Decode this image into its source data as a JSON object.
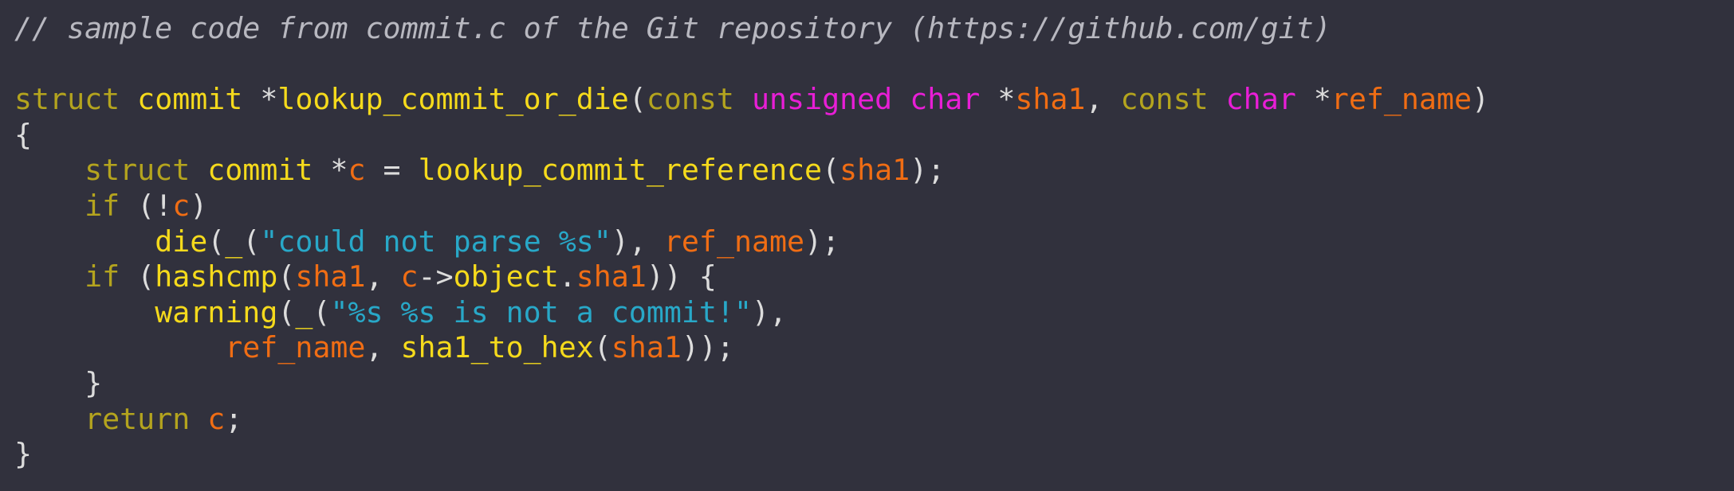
{
  "code": {
    "lines": [
      [
        {
          "t": "// sample code from commit.c of the Git repository (https://github.com/git)",
          "c": "comment"
        }
      ],
      [],
      [
        {
          "t": "struct",
          "c": "kw"
        },
        {
          "t": " ",
          "c": "pl"
        },
        {
          "t": "commit",
          "c": "fn"
        },
        {
          "t": " *",
          "c": "pl"
        },
        {
          "t": "lookup_commit_or_die",
          "c": "fn"
        },
        {
          "t": "(",
          "c": "pl"
        },
        {
          "t": "const",
          "c": "kw"
        },
        {
          "t": " ",
          "c": "pl"
        },
        {
          "t": "unsigned",
          "c": "kw2"
        },
        {
          "t": " ",
          "c": "pl"
        },
        {
          "t": "char",
          "c": "kw2"
        },
        {
          "t": " *",
          "c": "pl"
        },
        {
          "t": "sha1",
          "c": "var"
        },
        {
          "t": ", ",
          "c": "pl"
        },
        {
          "t": "const",
          "c": "kw"
        },
        {
          "t": " ",
          "c": "pl"
        },
        {
          "t": "char",
          "c": "kw2"
        },
        {
          "t": " *",
          "c": "pl"
        },
        {
          "t": "ref_name",
          "c": "var"
        },
        {
          "t": ")",
          "c": "pl"
        }
      ],
      [
        {
          "t": "{",
          "c": "pl"
        }
      ],
      [
        {
          "t": "    ",
          "c": "pl"
        },
        {
          "t": "struct",
          "c": "kw"
        },
        {
          "t": " ",
          "c": "pl"
        },
        {
          "t": "commit",
          "c": "fn"
        },
        {
          "t": " *",
          "c": "pl"
        },
        {
          "t": "c",
          "c": "var"
        },
        {
          "t": " = ",
          "c": "pl"
        },
        {
          "t": "lookup_commit_reference",
          "c": "fn"
        },
        {
          "t": "(",
          "c": "pl"
        },
        {
          "t": "sha1",
          "c": "var"
        },
        {
          "t": ");",
          "c": "pl"
        }
      ],
      [
        {
          "t": "    ",
          "c": "pl"
        },
        {
          "t": "if",
          "c": "kw"
        },
        {
          "t": " (!",
          "c": "pl"
        },
        {
          "t": "c",
          "c": "var"
        },
        {
          "t": ")",
          "c": "pl"
        }
      ],
      [
        {
          "t": "        ",
          "c": "pl"
        },
        {
          "t": "die",
          "c": "fn"
        },
        {
          "t": "(",
          "c": "pl"
        },
        {
          "t": "_",
          "c": "fn"
        },
        {
          "t": "(",
          "c": "pl"
        },
        {
          "t": "\"could not parse %s\"",
          "c": "str"
        },
        {
          "t": "), ",
          "c": "pl"
        },
        {
          "t": "ref_name",
          "c": "var"
        },
        {
          "t": ");",
          "c": "pl"
        }
      ],
      [
        {
          "t": "    ",
          "c": "pl"
        },
        {
          "t": "if",
          "c": "kw"
        },
        {
          "t": " (",
          "c": "pl"
        },
        {
          "t": "hashcmp",
          "c": "fn"
        },
        {
          "t": "(",
          "c": "pl"
        },
        {
          "t": "sha1",
          "c": "var"
        },
        {
          "t": ", ",
          "c": "pl"
        },
        {
          "t": "c",
          "c": "var"
        },
        {
          "t": "->",
          "c": "pl"
        },
        {
          "t": "object",
          "c": "fn"
        },
        {
          "t": ".",
          "c": "pl"
        },
        {
          "t": "sha1",
          "c": "var"
        },
        {
          "t": ")) {",
          "c": "pl"
        }
      ],
      [
        {
          "t": "        ",
          "c": "pl"
        },
        {
          "t": "warning",
          "c": "fn"
        },
        {
          "t": "(",
          "c": "pl"
        },
        {
          "t": "_",
          "c": "fn"
        },
        {
          "t": "(",
          "c": "pl"
        },
        {
          "t": "\"%s %s is not a commit!\"",
          "c": "str"
        },
        {
          "t": "),",
          "c": "pl"
        }
      ],
      [
        {
          "t": "            ",
          "c": "pl"
        },
        {
          "t": "ref_name",
          "c": "var"
        },
        {
          "t": ", ",
          "c": "pl"
        },
        {
          "t": "sha1_to_hex",
          "c": "fn"
        },
        {
          "t": "(",
          "c": "pl"
        },
        {
          "t": "sha1",
          "c": "var"
        },
        {
          "t": "));",
          "c": "pl"
        }
      ],
      [
        {
          "t": "    ",
          "c": "pl"
        },
        {
          "t": "}",
          "c": "pl"
        }
      ],
      [
        {
          "t": "    ",
          "c": "pl"
        },
        {
          "t": "return",
          "c": "kw"
        },
        {
          "t": " ",
          "c": "pl"
        },
        {
          "t": "c",
          "c": "var"
        },
        {
          "t": ";",
          "c": "pl"
        }
      ],
      [
        {
          "t": "}",
          "c": "pl"
        }
      ]
    ]
  },
  "colors": {
    "background": "#31313d",
    "comment": "#b8b8c0",
    "keyword": "#b4a41e",
    "type_keyword": "#e81ed6",
    "identifier": "#f5da1c",
    "variable": "#f06d14",
    "string": "#28a8c8",
    "plain": "#dcdcdc"
  }
}
